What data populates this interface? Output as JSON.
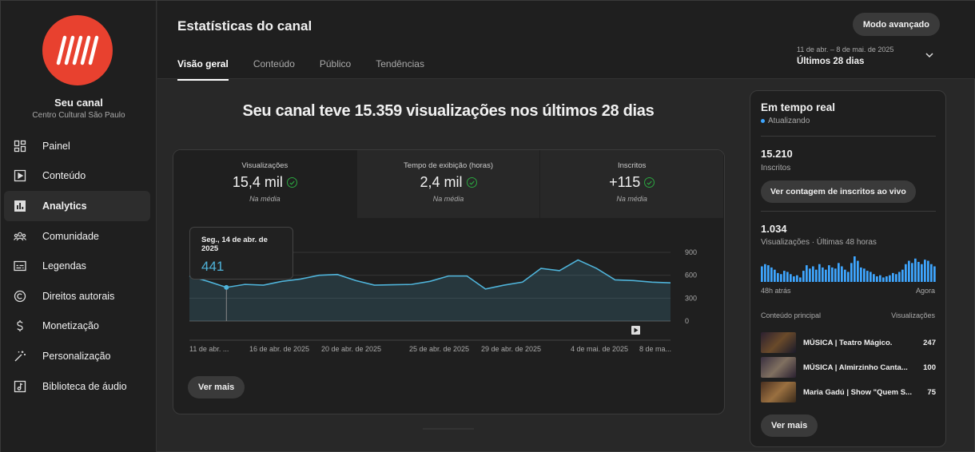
{
  "channel": {
    "name": "Seu canal",
    "subtitle": "Centro Cultural São Paulo"
  },
  "sidebar": {
    "items": [
      {
        "label": "Painel",
        "icon": "dashboard-icon"
      },
      {
        "label": "Conteúdo",
        "icon": "content-icon"
      },
      {
        "label": "Analytics",
        "icon": "analytics-icon"
      },
      {
        "label": "Comunidade",
        "icon": "community-icon"
      },
      {
        "label": "Legendas",
        "icon": "subtitles-icon"
      },
      {
        "label": "Direitos autorais",
        "icon": "copyright-icon"
      },
      {
        "label": "Monetização",
        "icon": "dollar-icon"
      },
      {
        "label": "Personalização",
        "icon": "magic-wand-icon"
      },
      {
        "label": "Biblioteca de áudio",
        "icon": "audio-library-icon"
      }
    ],
    "active_index": 2
  },
  "header": {
    "title": "Estatísticas do canal",
    "tabs": [
      "Visão geral",
      "Conteúdo",
      "Público",
      "Tendências"
    ],
    "advanced_button": "Modo avançado",
    "date_small": "11 de abr. – 8 de mai. de 2025",
    "date_main": "Últimos 28 dias"
  },
  "main": {
    "headline": "Seu canal teve 15.359 visualizações nos últimos 28 dias",
    "metrics": [
      {
        "label": "Visualizações",
        "value": "15,4 mil",
        "sub": "Na média"
      },
      {
        "label": "Tempo de exibição (horas)",
        "value": "2,4 mil",
        "sub": "Na média"
      },
      {
        "label": "Inscritos",
        "value": "+115",
        "sub": "Na média"
      }
    ],
    "tooltip": {
      "date": "Seg., 14 de abr. de 2025",
      "value": "441"
    },
    "see_more": "Ver mais"
  },
  "chart_data": {
    "type": "area",
    "y_ticks": [
      "900",
      "600",
      "300",
      "0"
    ],
    "ylim": [
      0,
      900
    ],
    "x_tick_labels": [
      "11 de abr. ...",
      "16 de abr. de 2025",
      "20 de abr. de 2025",
      "25 de abr. de 2025",
      "29 de abr. de 2025",
      "4 de mai. de 2025",
      "8 de ma..."
    ],
    "series": [
      {
        "values": [
          590,
          520,
          441,
          480,
          470,
          520,
          550,
          600,
          610,
          530,
          470,
          475,
          480,
          520,
          590,
          590,
          420,
          470,
          510,
          690,
          660,
          800,
          690,
          540,
          530,
          510,
          500
        ]
      }
    ],
    "highlight_index": 2
  },
  "realtime": {
    "title": "Em tempo real",
    "status": "Atualizando",
    "subscribers": "15.210",
    "subscribers_label": "Inscritos",
    "live_button": "Ver contagem de inscritos ao vivo",
    "views": "1.034",
    "views_label": "Visualizações · Últimas 48 horas",
    "axis_left": "48h atrás",
    "axis_right": "Agora",
    "bars": [
      14,
      16,
      15,
      13,
      11,
      8,
      7,
      10,
      9,
      7,
      5,
      6,
      4,
      10,
      15,
      12,
      14,
      11,
      16,
      13,
      11,
      15,
      13,
      12,
      17,
      14,
      11,
      9,
      17,
      23,
      19,
      13,
      12,
      10,
      9,
      7,
      5,
      6,
      4,
      5,
      6,
      8,
      7,
      9,
      11,
      16,
      19,
      17,
      21,
      18,
      16,
      20,
      19,
      16,
      14
    ],
    "top_header_left": "Conteúdo principal",
    "top_header_right": "Visualizações",
    "top_content": [
      {
        "title": "MÚSICA | Teatro Mágico.",
        "views": "247"
      },
      {
        "title": "MÚSICA | Almirzinho Canta...",
        "views": "100"
      },
      {
        "title": "Maria Gadú | Show \"Quem S...",
        "views": "75"
      }
    ],
    "see_more": "Ver mais"
  },
  "colors": {
    "accent": "#3ea6ff",
    "line": "#4fb3d9",
    "logo": "#e8412f",
    "check": "#2ba640"
  }
}
